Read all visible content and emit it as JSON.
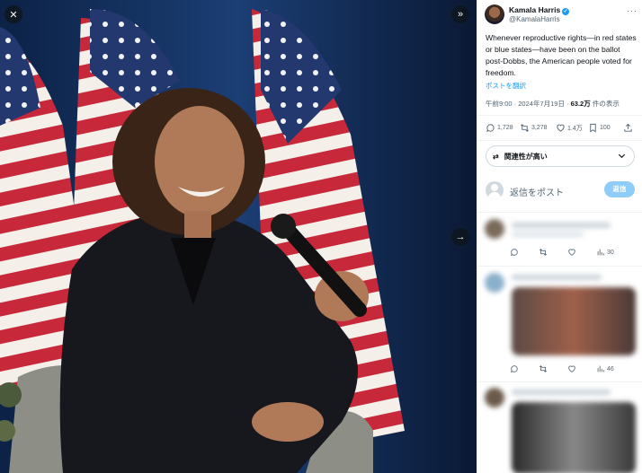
{
  "viewer": {
    "close_icon": "close-icon",
    "collapse_icon": "double-chevron-right-icon",
    "next_icon": "arrow-right-icon"
  },
  "tweet": {
    "author_name": "Kamala Harris",
    "author_handle": "@KamalaHarris",
    "more_icon": "more-icon",
    "text": "Whenever reproductive rights—in red states or blue states—have been on the ballot post-Dobbs, the American people voted for freedom.",
    "translate_label": "ポストを翻訳",
    "timestamp": "午前9:00 · 2024年7月19日 · ",
    "views_count": "63.2万",
    "views_label": " 件の表示",
    "replies": "1,728",
    "reposts": "3,278",
    "likes": "1.4万",
    "bookmarks": "100"
  },
  "relevance": {
    "label": "関連性が高い"
  },
  "reply": {
    "placeholder": "返信をポスト",
    "button": "返信"
  },
  "replies_list": [
    {
      "views": "30"
    },
    {
      "views": "46"
    }
  ],
  "colors": {
    "accent": "#1d9bf0",
    "reply_button_disabled": "#8ecdf8",
    "secondary_text": "#536471"
  }
}
